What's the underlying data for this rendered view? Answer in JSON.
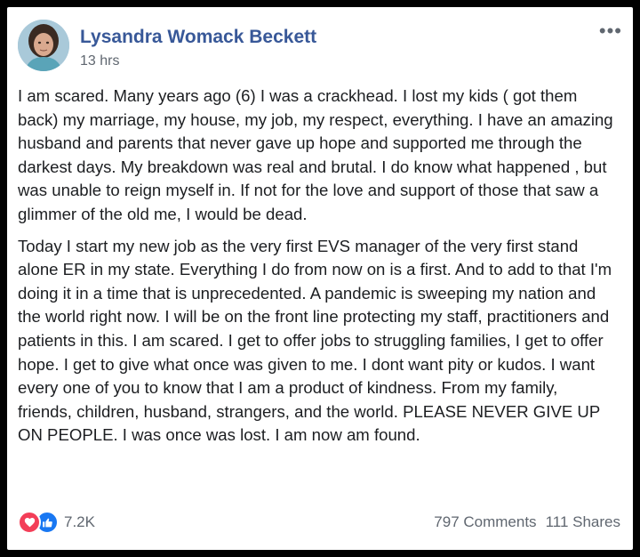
{
  "post": {
    "author_name": "Lysandra Womack Beckett",
    "timestamp": "13 hrs",
    "more_icon": "•••",
    "paragraphs": [
      "I am scared. Many years ago (6) I was a crackhead. I lost my kids ( got them back) my marriage, my house, my job, my respect, everything. I have an amazing husband and parents that never gave up hope and supported me through the darkest days. My breakdown was real and brutal. I do know what happened , but was unable to reign myself in. If not for the love and support of those that saw a glimmer of the old me, I would be dead.",
      "Today I start my new job as the very first EVS manager of the very first stand alone ER in my state. Everything I do from now on is a first. And to add to that I'm doing it in a time that is unprecedented. A pandemic is sweeping my nation and the world right now. I will be on the front line protecting my staff, practitioners and patients in this. I am scared. I get to offer jobs to struggling families, I get to offer hope. I get to give what once was given to me. I dont want pity or kudos. I want every one of you to know that I am a product of kindness. From my family, friends, children, husband, strangers, and the world. PLEASE NEVER GIVE UP ON PEOPLE. I was once was lost. I am now am found."
    ]
  },
  "footer": {
    "reactions_icons": [
      "love-icon",
      "like-icon"
    ],
    "reactions_count": "7.2K",
    "comments": "797 Comments",
    "shares": "111 Shares"
  },
  "colors": {
    "author": "#385898",
    "love": "#f33e58",
    "like": "#1877f2"
  }
}
